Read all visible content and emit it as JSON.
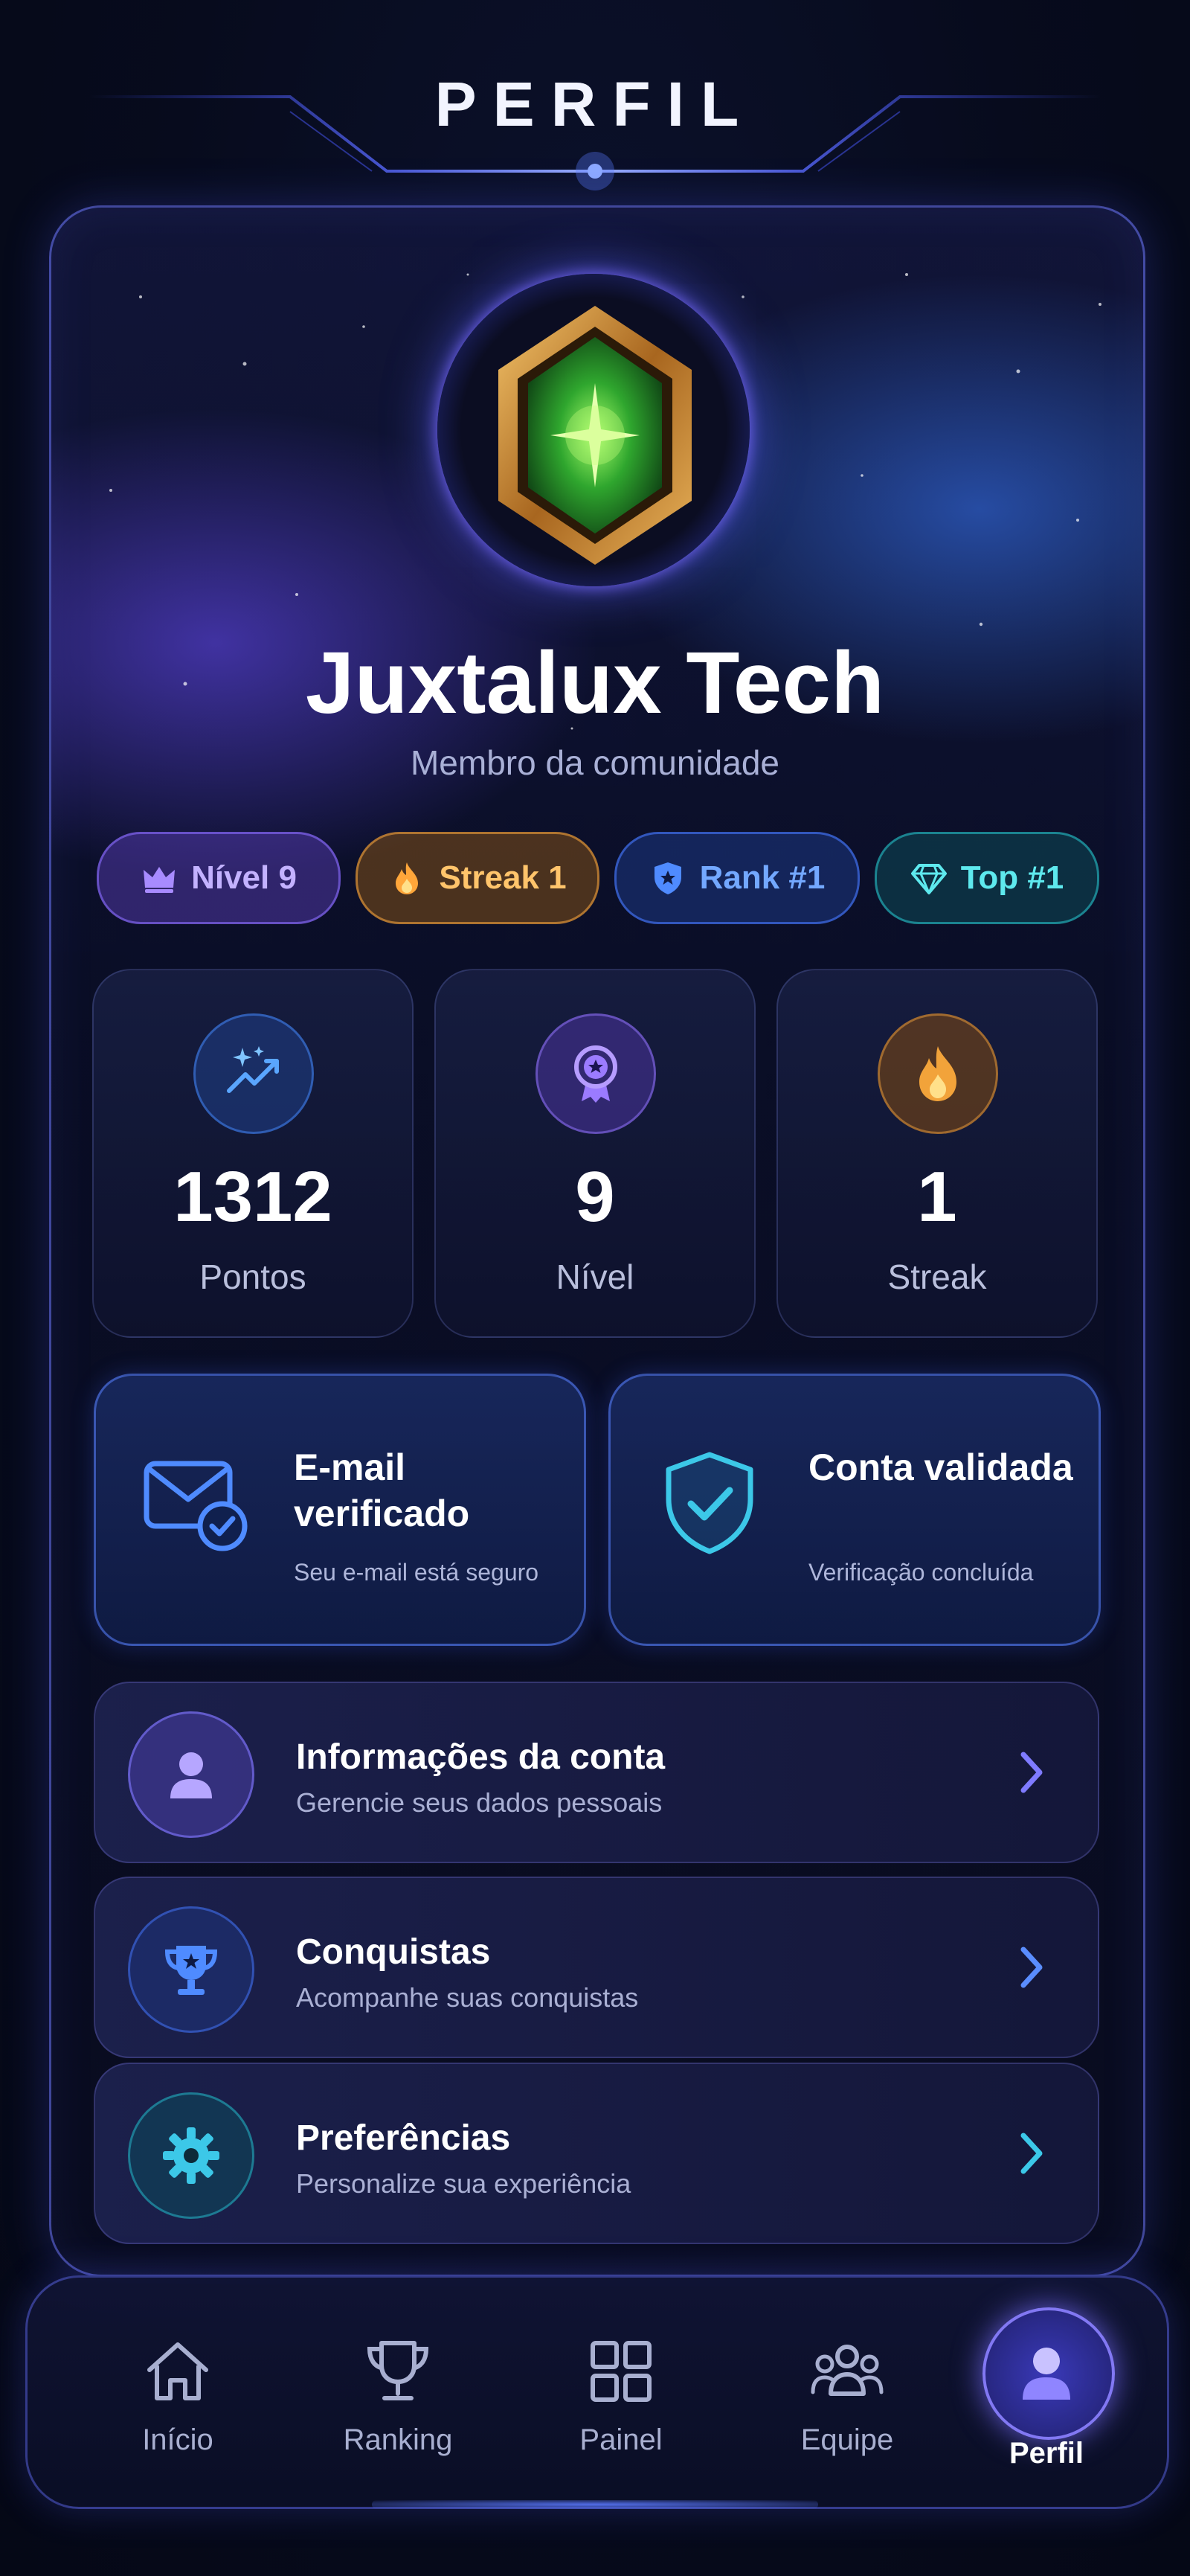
{
  "header": {
    "title": "PERFIL"
  },
  "profile": {
    "name": "Juxtalux Tech",
    "subtitle": "Membro da comunidade",
    "avatar_icon": "green-gem-icon"
  },
  "badges": [
    {
      "label": "Nível 9",
      "icon": "crown-icon",
      "color": "#c3b2ff"
    },
    {
      "label": "Streak 1",
      "icon": "flame-icon",
      "color": "#ffc46b"
    },
    {
      "label": "Rank #1",
      "icon": "shield-star-icon",
      "color": "#73a8ff"
    },
    {
      "label": "Top #1",
      "icon": "diamond-icon",
      "color": "#5ee9ee"
    }
  ],
  "stats": [
    {
      "value": "1312",
      "label": "Pontos",
      "icon": "trending-sparkle-icon"
    },
    {
      "value": "9",
      "label": "Nível",
      "icon": "medal-icon"
    },
    {
      "value": "1",
      "label": "Streak",
      "icon": "flame-icon"
    }
  ],
  "verification": [
    {
      "title": "E-mail verificado",
      "description": "Seu e-mail está seguro",
      "icon": "mail-check-icon"
    },
    {
      "title": "Conta validada",
      "description": "Verificação concluída",
      "icon": "shield-check-icon"
    }
  ],
  "menu": [
    {
      "title": "Informações da conta",
      "description": "Gerencie seus dados pessoais",
      "icon": "user-icon"
    },
    {
      "title": "Conquistas",
      "description": "Acompanhe suas conquistas",
      "icon": "trophy-icon"
    },
    {
      "title": "Preferências",
      "description": "Personalize sua experiência",
      "icon": "gear-icon"
    }
  ],
  "nav": {
    "items": [
      {
        "label": "Início",
        "icon": "home-icon"
      },
      {
        "label": "Ranking",
        "icon": "trophy-icon"
      },
      {
        "label": "Painel",
        "icon": "grid-icon"
      },
      {
        "label": "Equipe",
        "icon": "team-icon"
      },
      {
        "label": "Perfil",
        "icon": "user-icon",
        "active": true
      }
    ]
  },
  "colors": {
    "background": "#070b1d",
    "accent": "#6f66ff",
    "level": "#8f6bff",
    "streak": "#f2a33a",
    "rank": "#4f8bff",
    "top": "#2fd3d8"
  }
}
